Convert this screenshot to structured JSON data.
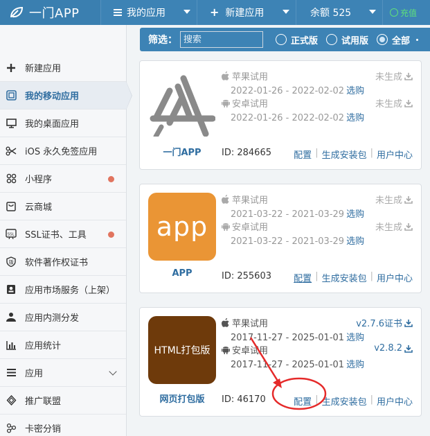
{
  "topbar": {
    "brand": "一门APP",
    "my_apps": "我的应用",
    "new_app": "新建应用",
    "balance": "余额 525",
    "recharge": "充值"
  },
  "sidebar": {
    "items": [
      {
        "label": "新建应用",
        "icon": "plus-icon"
      },
      {
        "label": "我的移动应用",
        "icon": "mobile-app-icon"
      },
      {
        "label": "我的桌面应用",
        "icon": "desktop-icon"
      },
      {
        "label": "iOS 永久免签应用",
        "icon": "scissors-icon"
      },
      {
        "label": "小程序",
        "icon": "mini-program-icon"
      },
      {
        "label": "云商城",
        "icon": "shop-icon"
      },
      {
        "label": "SSL证书、工具",
        "icon": "ssl-icon"
      },
      {
        "label": "软件著作权证书",
        "icon": "copyright-icon"
      },
      {
        "label": "应用市场服务（上架）",
        "icon": "market-icon"
      },
      {
        "label": "应用内测分发",
        "icon": "distribute-icon"
      },
      {
        "label": "应用统计",
        "icon": "stats-icon"
      },
      {
        "label": "应用",
        "icon": "menu-icon"
      },
      {
        "label": "推广联盟",
        "icon": "diamond-icon"
      },
      {
        "label": "卡密分销",
        "icon": "share-icon"
      }
    ]
  },
  "filter": {
    "label": "筛选：",
    "search_placeholder": "搜索",
    "options": [
      "正式版",
      "试用版",
      "全部"
    ],
    "selected": "全部"
  },
  "colors": {
    "topbar": "#3d83b5",
    "link": "#2f6da0",
    "recharge": "#5fe07a",
    "dot": "#e1745f",
    "app_orange": "#ea9535",
    "html_brown": "#6e3a0b"
  },
  "cards": [
    {
      "name": "一门APP",
      "icon": "app-store-icon",
      "ios_label": "苹果试用",
      "ios_date": "2022-01-26 - 2022-02-02",
      "ios_status": "未生成",
      "android_label": "安卓试用",
      "android_date": "2022-01-26 - 2022-02-02",
      "android_status": "未生成",
      "buy": "选购",
      "id": "ID: 284665",
      "links": [
        "配置",
        "生成安装包",
        "用户中心"
      ]
    },
    {
      "name": "APP",
      "icon_text": "app",
      "ios_label": "苹果试用",
      "ios_date": "2021-03-22 - 2021-03-29",
      "ios_status": "未生成",
      "android_label": "安卓试用",
      "android_date": "2021-03-22 - 2021-03-29",
      "android_status": "未生成",
      "buy": "选购",
      "id": "ID: 255603",
      "links": [
        "配置",
        "生成安装包",
        "用户中心"
      ]
    },
    {
      "name": "网页打包版",
      "icon_text": "HTML打包版",
      "ios_label": "苹果试用",
      "ios_date": "2017-11-27 - 2025-01-01",
      "ios_status": "v2.7.6证书",
      "android_label": "安卓试用",
      "android_date": "2017-11-27 - 2025-01-01",
      "android_status": "v2.8.2",
      "buy": "选购",
      "id": "ID: 46170",
      "links": [
        "配置",
        "生成安装包",
        "用户中心"
      ]
    }
  ]
}
